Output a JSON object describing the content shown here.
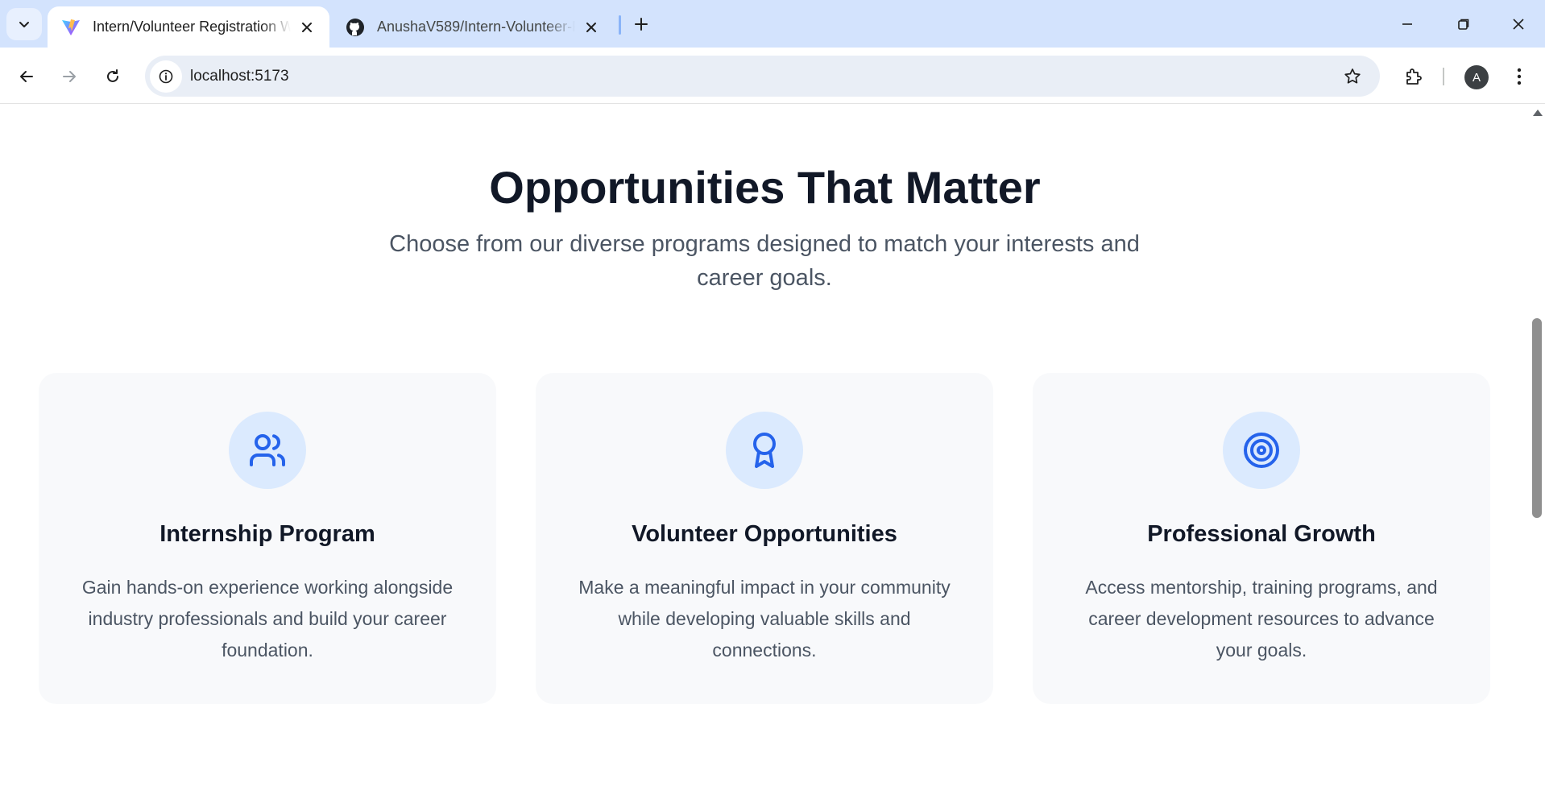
{
  "browser": {
    "tabs": [
      {
        "title": "Intern/Volunteer Registration W",
        "active": true
      },
      {
        "title": "AnushaV589/Intern-Volunteer-R",
        "active": false
      }
    ],
    "address": "localhost:5173",
    "profile_initial": "A"
  },
  "page": {
    "heading": "Opportunities That Matter",
    "subheading": "Choose from our diverse programs designed to match your interests and career goals.",
    "cards": [
      {
        "icon": "users-icon",
        "title": "Internship Program",
        "description": "Gain hands-on experience working alongside industry professionals and build your career foundation."
      },
      {
        "icon": "award-icon",
        "title": "Volunteer Opportunities",
        "description": "Make a meaningful impact in your community while developing valuable skills and connections."
      },
      {
        "icon": "target-icon",
        "title": "Professional Growth",
        "description": "Access mentorship, training programs, and career development resources to advance your goals."
      }
    ]
  },
  "colors": {
    "accent": "#2563eb",
    "icon_bg": "#dbeafe",
    "card_bg": "#f8f9fb",
    "tabstrip_bg": "#d3e3fd"
  }
}
